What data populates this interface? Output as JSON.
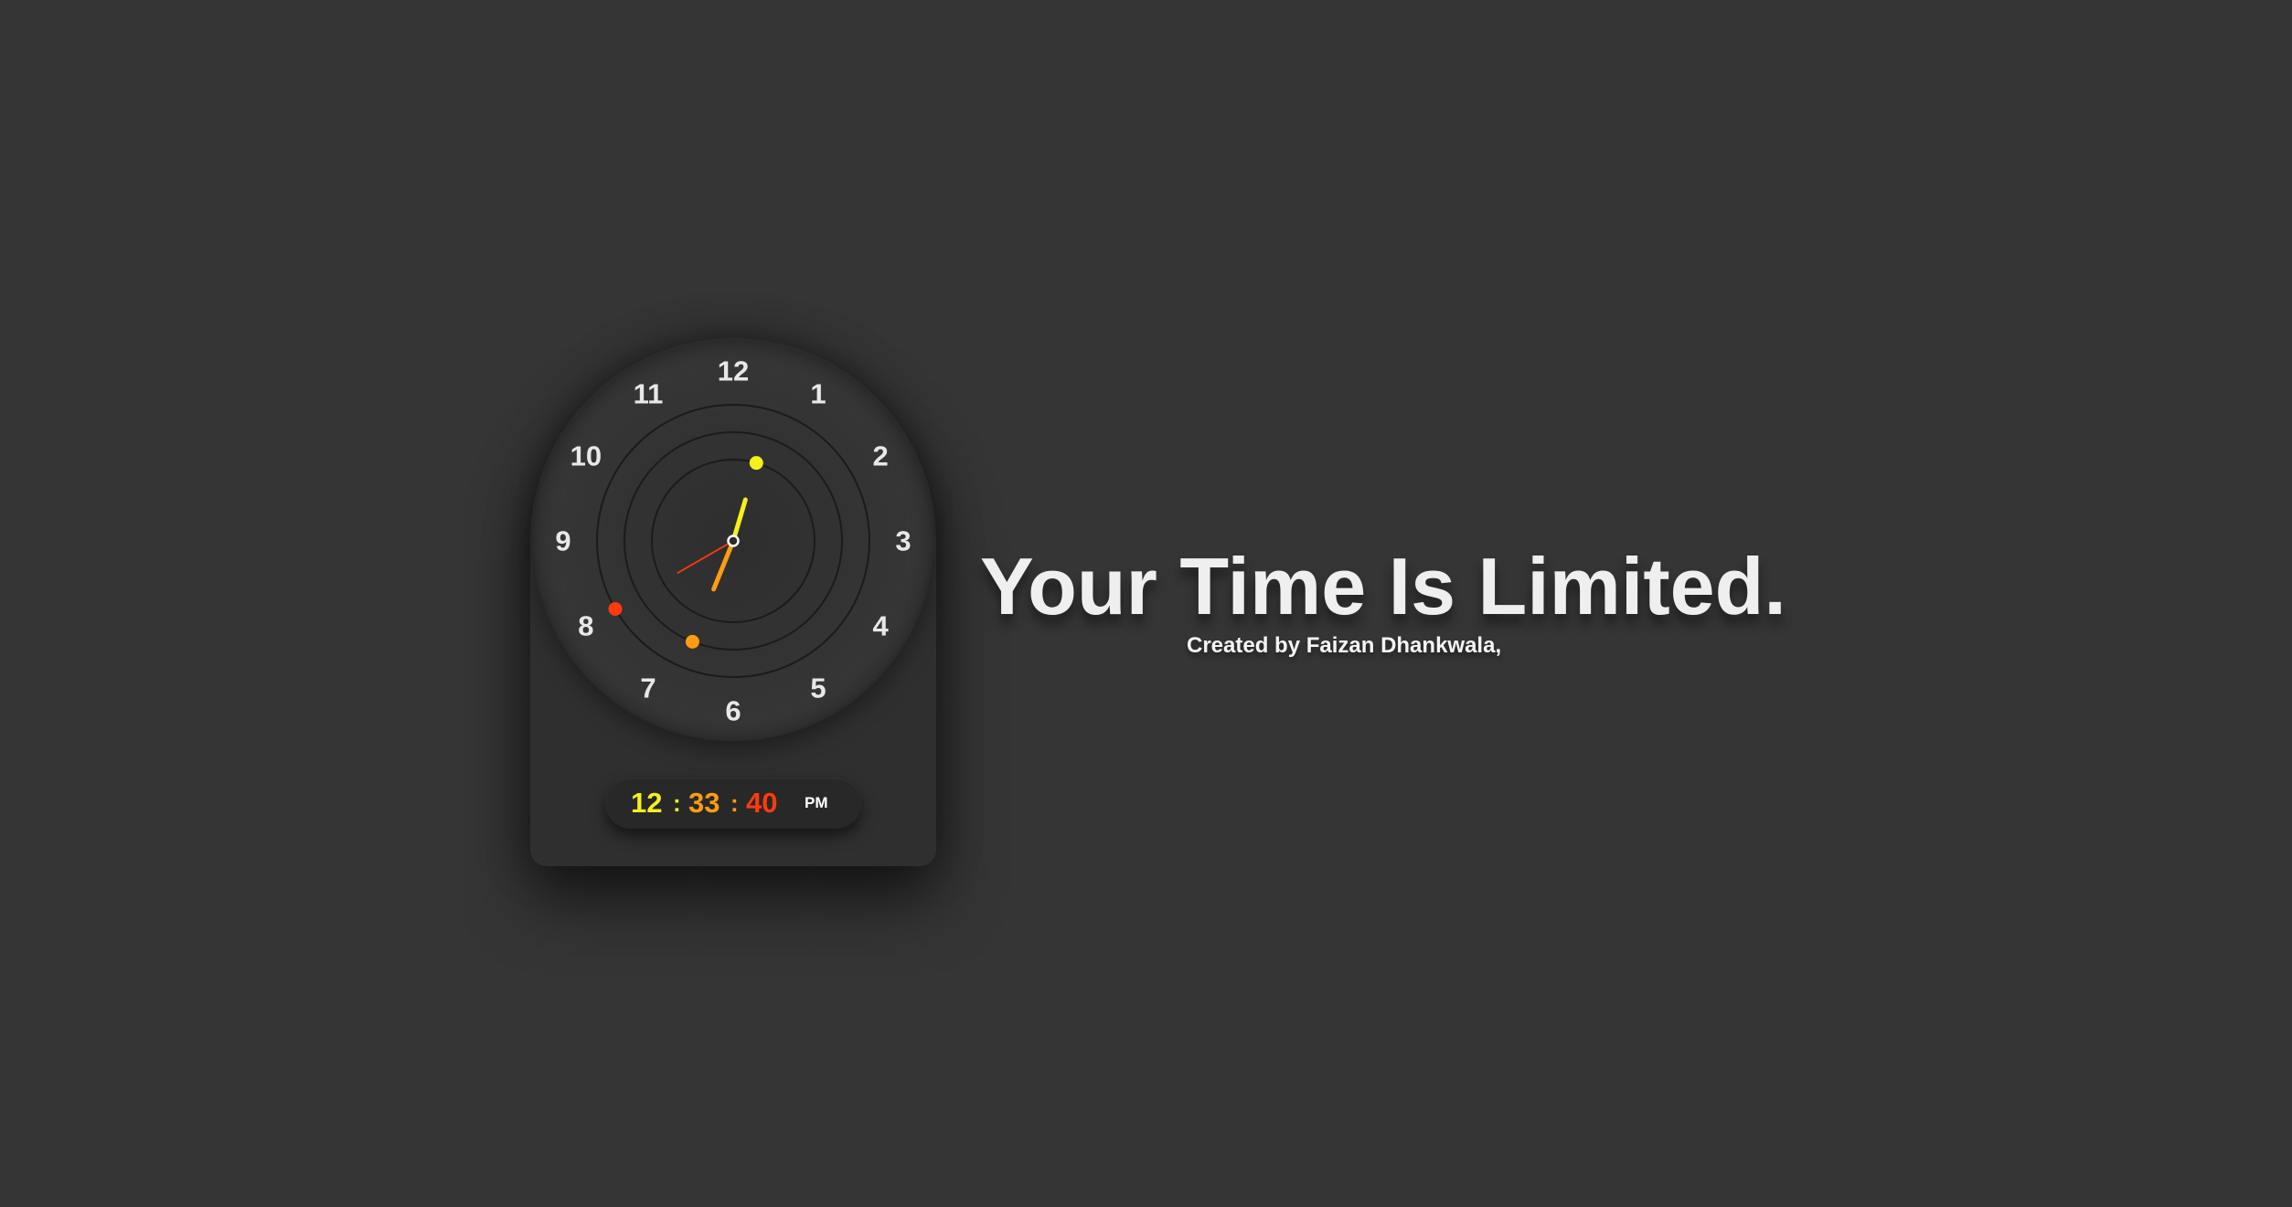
{
  "page": {
    "background": "#353535"
  },
  "clock": {
    "dial_numbers": [
      "12",
      "1",
      "2",
      "3",
      "4",
      "5",
      "6",
      "7",
      "8",
      "9",
      "10",
      "11"
    ],
    "time": {
      "hours": 12,
      "minutes": 33,
      "seconds": 40
    },
    "colors": {
      "hour": "#f5f119",
      "minute": "#ff9c11",
      "second": "#ff3b0c"
    },
    "digital": {
      "hours": "12",
      "minutes": "33",
      "seconds": "40",
      "separator": ":",
      "ampm": "PM"
    }
  },
  "headline": {
    "title": "Your Time Is Limited.",
    "credit": "Created by Faizan Dhankwala,"
  }
}
